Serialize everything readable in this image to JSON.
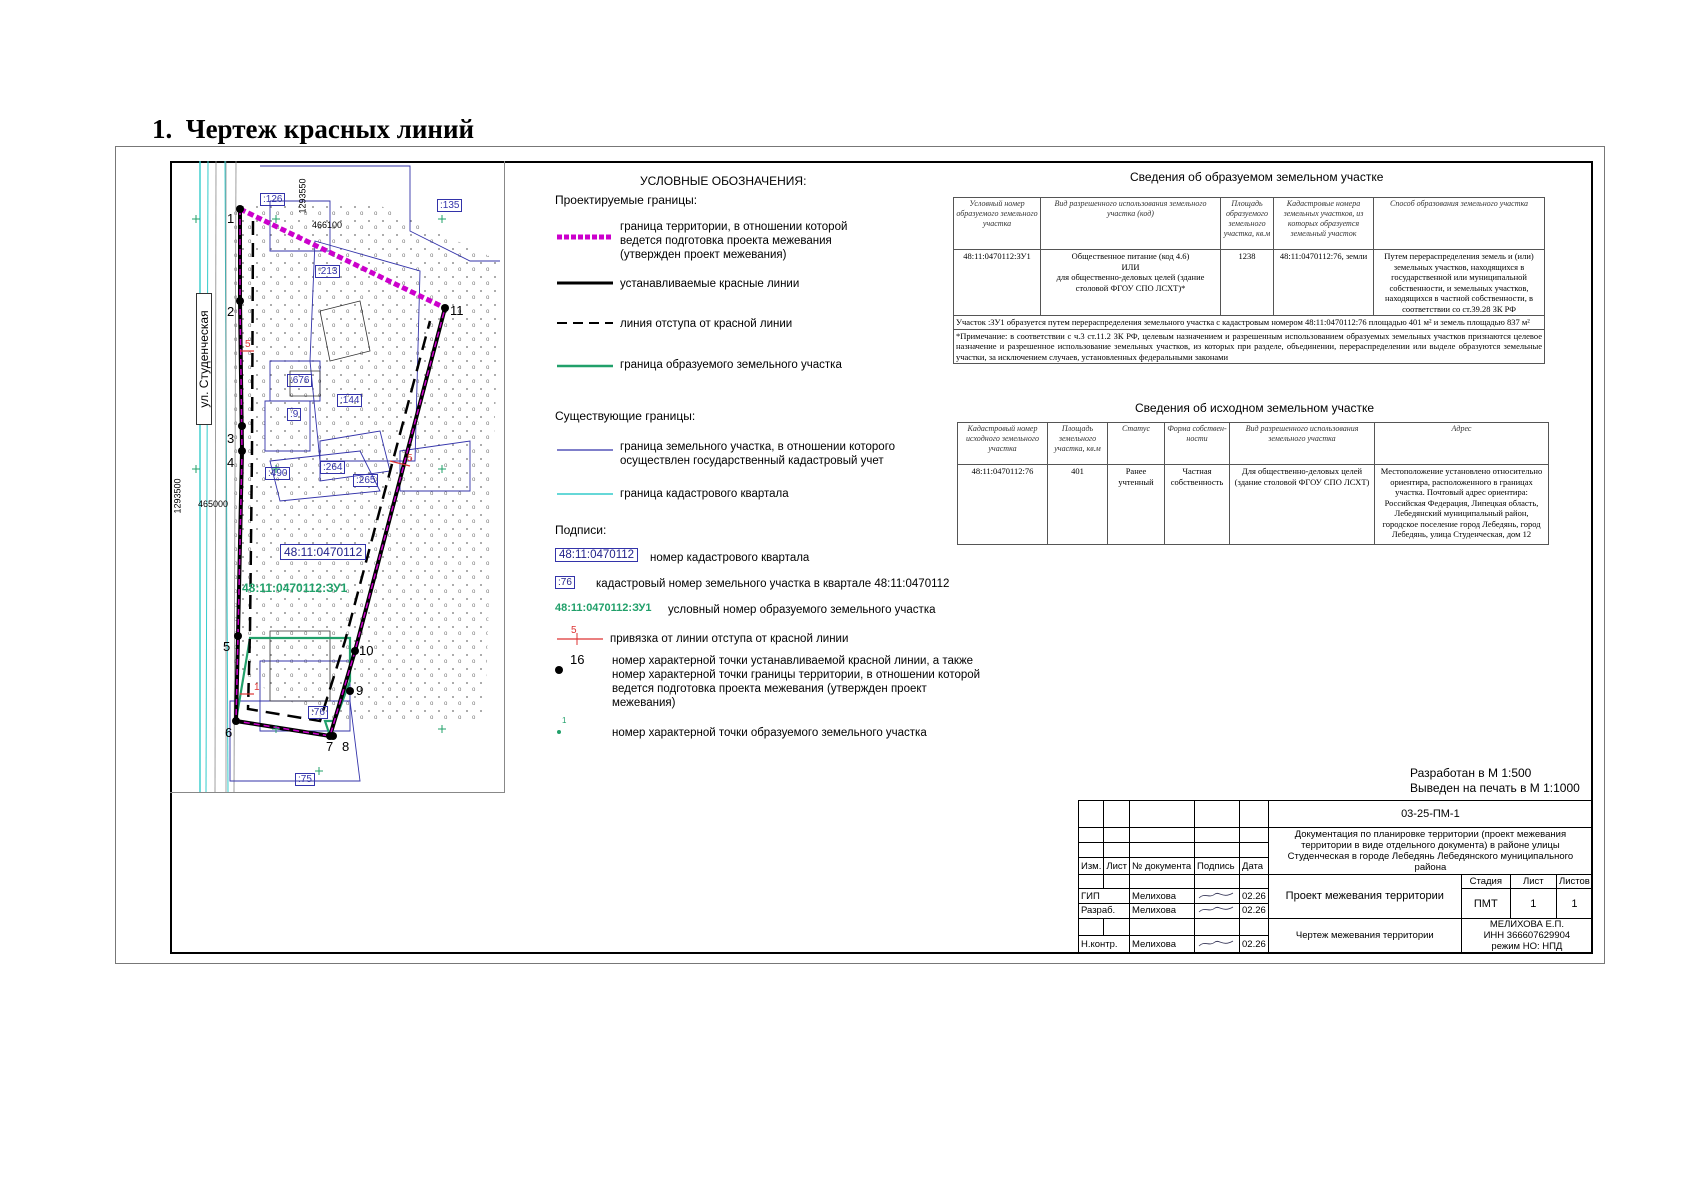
{
  "heading": {
    "number": "1.",
    "title": "Чертеж красных линий"
  },
  "map": {
    "street": "ул. Студенческая",
    "coords": [
      "466100",
      "1293550",
      "1293500",
      "465000"
    ],
    "quarter_number": "48:11:0470112",
    "parcel_label": "48:11:0470112:ЗУ1",
    "parcels": [
      ":126",
      ":135",
      ":213",
      ":676",
      ":144",
      ":9",
      ":490",
      ":264",
      ":265",
      ":76",
      ":75"
    ],
    "points": [
      "1",
      "2",
      "3",
      "4",
      "5",
      "6",
      "7",
      "8",
      "9",
      "10",
      "11"
    ],
    "offsets": [
      "5",
      "5",
      "1"
    ]
  },
  "legend": {
    "title": "УСЛОВНЫЕ ОБОЗНАЧЕНИЯ:",
    "projected_heading": "Проектируемые границы:",
    "projected": [
      {
        "text": "граница территории, в отношении которой ведется подготовка проекта межевания (утвержден проект межевания)",
        "color": "#cc00cc"
      },
      {
        "text": "устанавливаемые красные линии",
        "color": "#000000"
      },
      {
        "text": "линия отступа от красной линии",
        "color": "#000000"
      },
      {
        "text": "граница образуемого земельного участка",
        "color": "#21a06a"
      }
    ],
    "existing_heading": "Существующие границы:",
    "existing": [
      {
        "text": "граница земельного участка, в отношении которого осуществлен государственный кадастровый учет",
        "color": "#3333aa"
      },
      {
        "text": "граница кадастрового квартала",
        "color": "#33cccc"
      }
    ],
    "labels_heading": "Подписи:",
    "labels": [
      {
        "sample": "48:11:0470112",
        "text": "номер кадастрового квартала"
      },
      {
        "sample": ":76",
        "text": "кадастровый номер земельного участка в квартале 48:11:0470112"
      },
      {
        "sample": "48:11:0470112:ЗУ1",
        "text": "условный номер образуемого земельного участка"
      },
      {
        "sample": "5",
        "text": "привязка от линии отступа от красной линии"
      },
      {
        "sample": "16",
        "text": "номер характерной точки устанавливаемой красной линии, а также номер характерной точки границы территории, в отношении которой ведется подготовка проекта межевания (утвержден проект межевания)"
      },
      {
        "sample": "1",
        "text": "номер характерной точки образуемого земельного участка"
      }
    ]
  },
  "table1": {
    "title": "Сведения об образуемом земельном участке",
    "headers": [
      "Условный номер образуемого земельного участка",
      "Вид разрешенного использования земельного участка (код)",
      "Площадь образуемого земельного участка, кв.м",
      "Кадастровые номера земельных участков, из которых образуется земельный участок",
      "Способ образования земельного участка"
    ],
    "row": {
      "num": "48:11:0470112:ЗУ1",
      "use_1": "Общественное питание (код 4.6)",
      "use_2": "ИЛИ",
      "use_3": "для общественно-деловых целей (здание столовой ФГОУ СПО ЛСХТ)*",
      "area": "1238",
      "source": "48:11:0470112:76, земли",
      "method": "Путем перераспределения земель и (или) земельных участков, находящихся в государственной или муниципальной собственности, и земельных участков, находящихся в частной собственности, в соответствии со ст.39.28 ЗК РФ"
    },
    "note1": "Участок :ЗУ1 образуется путем перераспределения земельного участка с кадастровым номером 48:11:0470112:76 площадью 401 м² и земель площадью 837 м²",
    "note2": "*Примечание: в соответствии с ч.3 ст.11.2 ЗК РФ, целевым назначением и разрешенным использованием образуемых земельных участков признаются целевое назначение и разрешенное использование земельных участков, из которых при разделе, объединении, перераспределении или выделе образуются земельные участки, за исключением случаев, установленных федеральными законами"
  },
  "table2": {
    "title": "Сведения об исходном земельном участке",
    "headers": [
      "Кадастровый номер исходного земельного участка",
      "Площадь земельного участка, кв.м",
      "Статус",
      "Форма собствен-ности",
      "Вид разрешенного использования земельного участка",
      "Адрес"
    ],
    "row": [
      "48:11:0470112:76",
      "401",
      "Ранее учтенный",
      "Частная собственность",
      "Для общественно-деловых целей (здание столовой ФГОУ СПО ЛСХТ)",
      "Местоположение установлено относительно ориентира, расположенного в границах участка. Почтовый адрес ориентира: Российская Федерация, Липецкая область, Лебедянский муниципальный район, городское поселение город Лебедянь, город Лебедянь, улица Студенческая, дом 12"
    ]
  },
  "scale": {
    "developed": "Разработан в М 1:500",
    "printed": "Выведен на печать в М 1:1000"
  },
  "stamp": {
    "code": "03-25-ПМ-1",
    "doc_title": "Документация по планировке территории (проект межевания территории в виде отдельного документа) в районе улицы Студенческая в городе Лебедянь Лебедянского муниципального района",
    "col_headers": [
      "Изм.",
      "Лист",
      "№ документа",
      "Подпись",
      "Дата"
    ],
    "people": [
      {
        "role": "ГИП",
        "name": "Мелихова",
        "date": "02.26"
      },
      {
        "role": "Разраб.",
        "name": "Мелихова",
        "date": "02.26"
      },
      {
        "role": "Н.контр.",
        "name": "Мелихова",
        "date": "02.26"
      }
    ],
    "project": "Проект межевания территории",
    "sheet_title": "Чертеж межевания территории",
    "stage_headers": [
      "Стадия",
      "Лист",
      "Листов"
    ],
    "stage_values": [
      "ПМТ",
      "1",
      "1"
    ],
    "org_1": "МЕЛИХОВА Е.П.",
    "org_2": "ИНН 366607629904",
    "org_3": "режим НО: НПД"
  }
}
